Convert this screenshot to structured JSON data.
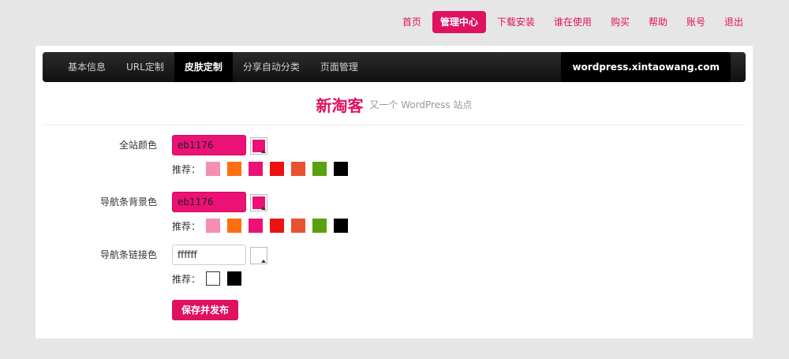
{
  "top_nav": [
    {
      "label": "首页",
      "active": false
    },
    {
      "label": "管理中心",
      "active": true
    },
    {
      "label": "下载安装",
      "active": false
    },
    {
      "label": "谁在使用",
      "active": false
    },
    {
      "label": "购买",
      "active": false
    },
    {
      "label": "帮助",
      "active": false
    },
    {
      "label": "账号",
      "active": false
    },
    {
      "label": "退出",
      "active": false
    }
  ],
  "menu": {
    "tabs": [
      {
        "label": "基本信息",
        "active": false
      },
      {
        "label": "URL定制",
        "active": false
      },
      {
        "label": "皮肤定制",
        "active": true
      },
      {
        "label": "分享自动分类",
        "active": false
      },
      {
        "label": "页面管理",
        "active": false
      }
    ],
    "site": "wordpress.xintaowang.com"
  },
  "header": {
    "name": "新淘客",
    "tagline": "又一个 WordPress 站点"
  },
  "form": {
    "recommend_label": "推荐：",
    "rows": [
      {
        "label": "全站颜色",
        "value": "eb1176",
        "color": "#eb1176",
        "recommended": [
          "#f48fb1",
          "#ff6f0f",
          "#eb1176",
          "#ee1111",
          "#e8522e",
          "#5aa00f",
          "#000000"
        ]
      },
      {
        "label": "导航条背景色",
        "value": "eb1176",
        "color": "#eb1176",
        "recommended": [
          "#f48fb1",
          "#ff6f0f",
          "#eb1176",
          "#ee1111",
          "#e8522e",
          "#5aa00f",
          "#000000"
        ]
      },
      {
        "label": "导航条链接色",
        "value": "ffffff",
        "color": "#ffffff",
        "recommended": [
          "#ffffff",
          "#000000"
        ]
      }
    ],
    "save_label": "保存并发布"
  }
}
